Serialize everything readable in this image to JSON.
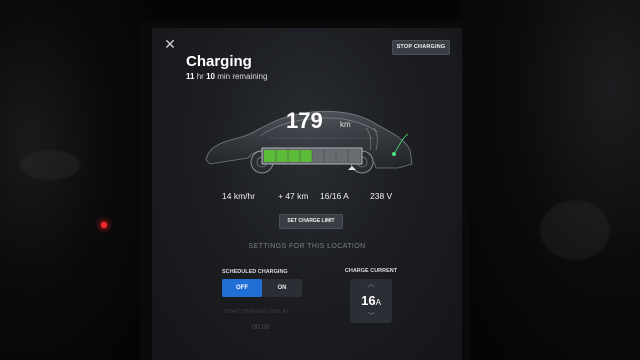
{
  "colors": {
    "accent_blue": "#1f6fd6",
    "battery_green": "#5dbb3a",
    "screen_bg": "#1c1e22"
  },
  "header": {
    "close_icon": "close-icon",
    "stop_label": "STOP CHARGING"
  },
  "status": {
    "title": "Charging",
    "hours": "11",
    "hr_unit": "hr",
    "minutes": "10",
    "min_suffix": "min remaining"
  },
  "battery": {
    "range_value": "179",
    "range_unit": "km",
    "charge_level": 0.5
  },
  "stats": {
    "rate": "14 km/hr",
    "added": "+ 47 km",
    "current": "16/16 A",
    "voltage": "238 V"
  },
  "limit_button": "SET CHARGE LIMIT",
  "location_settings": {
    "section_title": "SETTINGS FOR THIS LOCATION",
    "scheduled_label": "SCHEDULED CHARGING",
    "off_label": "OFF",
    "on_label": "ON",
    "scheduled_selected": "OFF",
    "start_label": "START CHARGING TIME AT",
    "start_time": "00:00",
    "current_label": "CHARGE CURRENT",
    "current_value": "16",
    "current_unit": "A"
  }
}
